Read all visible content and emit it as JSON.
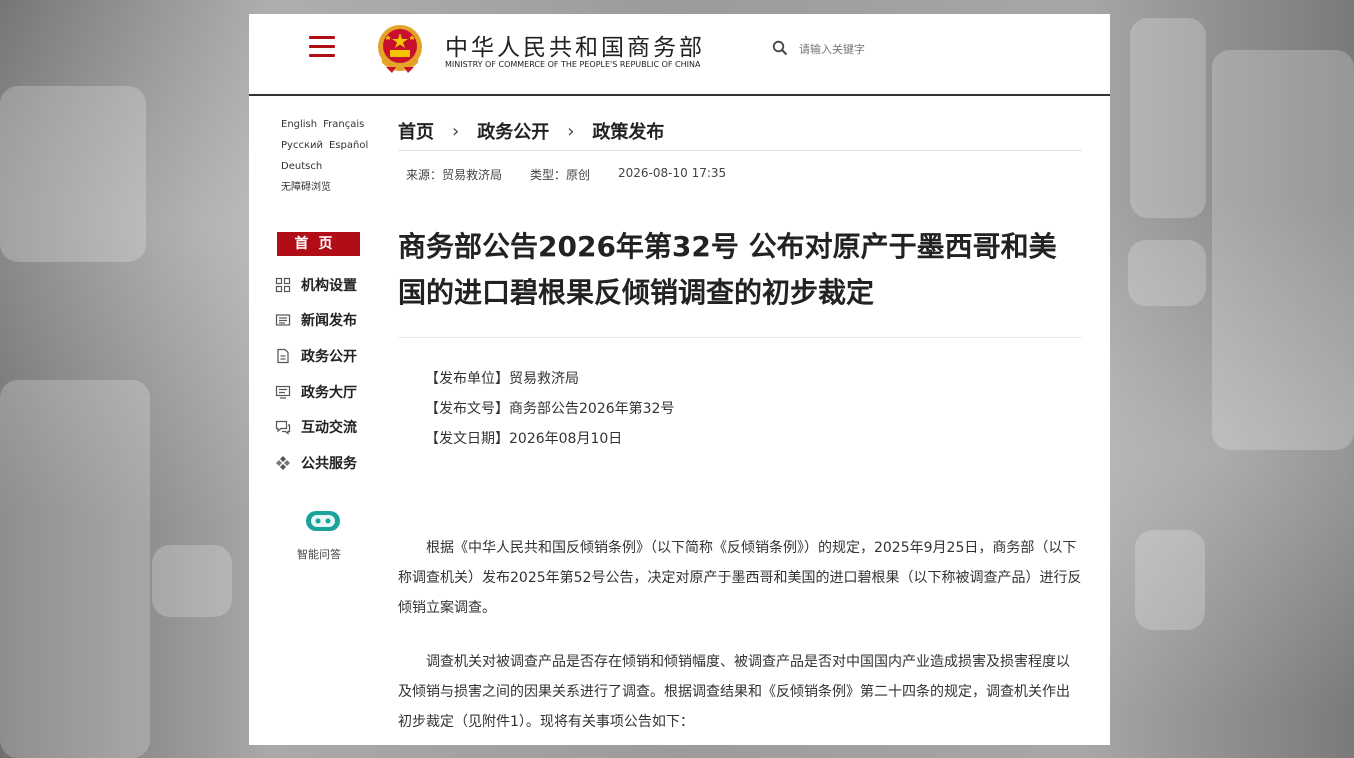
{
  "header": {
    "site_title": "中华人民共和国商务部",
    "site_subtitle": "MINISTRY OF COMMERCE OF THE PEOPLE'S REPUBLIC OF CHINA",
    "search_placeholder": "请输入关键字"
  },
  "languages": [
    "English",
    "Français",
    "Русский",
    "Español",
    "Deutsch"
  ],
  "accessibility": "无障碍浏览",
  "nav": {
    "home": "首页",
    "items": [
      {
        "label": "机构设置",
        "icon": "org-structure-icon"
      },
      {
        "label": "新闻发布",
        "icon": "news-icon"
      },
      {
        "label": "政务公开",
        "icon": "document-icon"
      },
      {
        "label": "政务大厅",
        "icon": "service-hall-icon"
      },
      {
        "label": "互动交流",
        "icon": "chat-icon"
      },
      {
        "label": "公共服务",
        "icon": "public-service-icon"
      }
    ]
  },
  "assistant": {
    "label": "智能问答",
    "icon": "robot-icon"
  },
  "breadcrumb": [
    "首页",
    "政务公开",
    "政策发布"
  ],
  "meta": {
    "source": "来源：贸易救济局",
    "type": "类型：原创",
    "datetime": "2026-08-10 17:35"
  },
  "article": {
    "title": "商务部公告2026年第32号 公布对原产于墨西哥和美国的进口碧根果反倾销调查的初步裁定",
    "info": [
      "【发布单位】贸易救济局",
      "【发布文号】商务部公告2026年第32号",
      "【发文日期】2026年08月10日"
    ],
    "paragraphs": [
      "根据《中华人民共和国反倾销条例》（以下简称《反倾销条例》）的规定，2025年9月25日，商务部（以下称调查机关）发布2025年第52号公告，决定对原产于墨西哥和美国的进口碧根果（以下称被调查产品）进行反倾销立案调查。",
      "调查机关对被调查产品是否存在倾销和倾销幅度、被调查产品是否对中国国内产业造成损害及损害程度以及倾销与损害之间的因果关系进行了调查。根据调查结果和《反倾销条例》第二十四条的规定，调查机关作出初步裁定（见附件1）。现将有关事项公告如下："
    ]
  },
  "colors": {
    "brand_red": "#b00d17"
  }
}
